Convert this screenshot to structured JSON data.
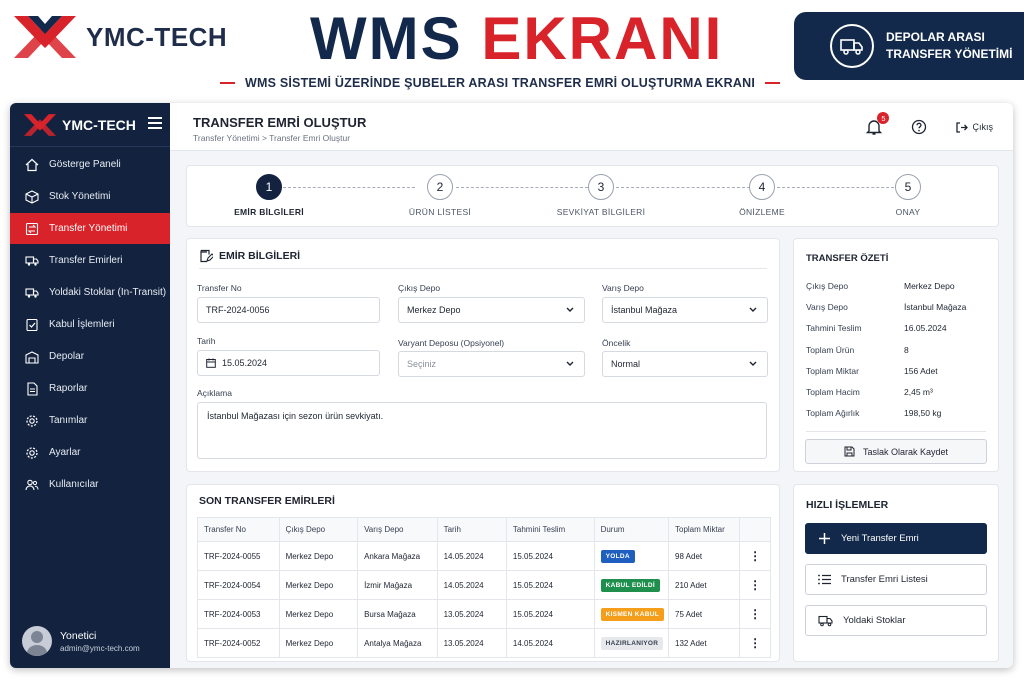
{
  "colors": {
    "brand_navy": "#13294b",
    "brand_red": "#d8232a",
    "sidebar_bg": "#13233f"
  },
  "banner": {
    "brand": "YMC-TECH",
    "headline_part1": "WMS",
    "headline_part2": "EKRANI",
    "subtitle": "WMS SİSTEMİ ÜZERİNDE ŞUBELER ARASI TRANSFER EMRİ OLUŞTURMA EKRANI",
    "badge_line1": "DEPOLAR ARASI",
    "badge_line2": "TRANSFER YÖNETİMİ"
  },
  "sidebar": {
    "brand": "YMC-TECH",
    "items": [
      {
        "label": "Gösterge Paneli",
        "icon": "home-icon"
      },
      {
        "label": "Stok Yönetimi",
        "icon": "box-icon"
      },
      {
        "label": "Transfer Yönetimi",
        "icon": "transfer-icon",
        "active": true
      },
      {
        "label": "Transfer Emirleri",
        "icon": "truck-icon"
      },
      {
        "label": "Yoldaki Stoklar (In-Transit)",
        "icon": "truck-icon"
      },
      {
        "label": "Kabul İşlemleri",
        "icon": "check-icon"
      },
      {
        "label": "Depolar",
        "icon": "warehouse-icon"
      },
      {
        "label": "Raporlar",
        "icon": "report-icon"
      },
      {
        "label": "Tanımlar",
        "icon": "gear-icon"
      },
      {
        "label": "Ayarlar",
        "icon": "gear-icon"
      },
      {
        "label": "Kullanıcılar",
        "icon": "users-icon"
      }
    ],
    "user_name": "Yonetici",
    "user_email": "admin@ymc-tech.com"
  },
  "topbar": {
    "title": "TRANSFER EMRİ OLUŞTUR",
    "breadcrumb": "Transfer Yönetimi  >  Transfer Emri Oluştur",
    "notification_count": "5",
    "logout": "Çıkış"
  },
  "steps": [
    {
      "number": "1",
      "label": "EMİR BİLGİLERİ",
      "active": true
    },
    {
      "number": "2",
      "label": "ÜRÜN LİSTESİ"
    },
    {
      "number": "3",
      "label": "SEVKİYAT BİLGİLERİ"
    },
    {
      "number": "4",
      "label": "ÖNİZLEME"
    },
    {
      "number": "5",
      "label": "ONAY"
    }
  ],
  "form": {
    "title": "EMİR BİLGİLERİ",
    "transfer_no_label": "Transfer No",
    "transfer_no": "TRF-2024-0056",
    "source_label": "Çıkış Depo",
    "source": "Merkez Depo",
    "dest_label": "Varış Depo",
    "dest": "İstanbul Mağaza",
    "date_label": "Tarih",
    "date": "15.05.2024",
    "variant_label": "Varyant Deposu (Opsiyonel)",
    "variant_placeholder": "Seçiniz",
    "priority_label": "Öncelik",
    "priority": "Normal",
    "desc_label": "Açıklama",
    "desc": "İstanbul Mağazası için sezon ürün sevkiyatı."
  },
  "recent": {
    "title": "SON TRANSFER EMİRLERİ",
    "columns": [
      "Transfer No",
      "Çıkış Depo",
      "Varış Depo",
      "Tarih",
      "Tahmini Teslim",
      "Durum",
      "Toplam Miktar"
    ],
    "rows": [
      {
        "no": "TRF-2024-0055",
        "src": "Merkez Depo",
        "dst": "Ankara Mağaza",
        "date": "14.05.2024",
        "eta": "15.05.2024",
        "status": "YOLDA",
        "status_color": "#1f5fbf",
        "status_text_color": "#ffffff",
        "qty": "98 Adet"
      },
      {
        "no": "TRF-2024-0054",
        "src": "Merkez Depo",
        "dst": "İzmir Mağaza",
        "date": "14.05.2024",
        "eta": "15.05.2024",
        "status": "KABUL EDİLDİ",
        "status_color": "#1f8f4e",
        "status_text_color": "#ffffff",
        "qty": "210 Adet"
      },
      {
        "no": "TRF-2024-0053",
        "src": "Merkez Depo",
        "dst": "Bursa Mağaza",
        "date": "13.05.2024",
        "eta": "15.05.2024",
        "status": "KISMEN KABUL",
        "status_color": "#f59e1b",
        "status_text_color": "#ffffff",
        "qty": "75 Adet"
      },
      {
        "no": "TRF-2024-0052",
        "src": "Merkez Depo",
        "dst": "Antalya Mağaza",
        "date": "13.05.2024",
        "eta": "14.05.2024",
        "status": "HAZIRLANIYOR",
        "status_color": "#e6e8ec",
        "status_text_color": "#374151",
        "qty": "132 Adet"
      }
    ]
  },
  "summary": {
    "title": "TRANSFER ÖZETİ",
    "rows": [
      {
        "label": "Çıkış Depo",
        "value": "Merkez Depo"
      },
      {
        "label": "Varış Depo",
        "value": "İstanbul Mağaza"
      },
      {
        "label": "Tahmini Teslim",
        "value": "16.05.2024"
      },
      {
        "label": "Toplam Ürün",
        "value": "8"
      },
      {
        "label": "Toplam Miktar",
        "value": "156 Adet"
      },
      {
        "label": "Toplam Hacim",
        "value": "2,45 m³"
      },
      {
        "label": "Toplam Ağırlık",
        "value": "198,50 kg"
      }
    ],
    "save_draft": "Taslak Olarak Kaydet"
  },
  "quick": {
    "title": "HIZLI İŞLEMLER",
    "new_transfer": "Yeni Transfer Emri",
    "transfer_list": "Transfer Emri Listesi",
    "in_transit": "Yoldaki Stoklar"
  }
}
